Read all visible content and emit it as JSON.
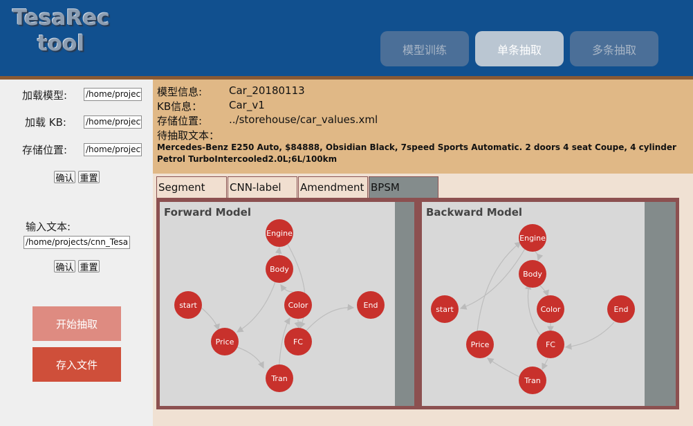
{
  "header": {
    "logo_line1": "TesaRec",
    "logo_line2": "tool",
    "nav": [
      {
        "label": "模型训练"
      },
      {
        "label": "单条抽取"
      },
      {
        "label": "多条抽取"
      }
    ]
  },
  "sidebar": {
    "load_model_label": "加载模型:",
    "load_model_value": "/home/projects",
    "load_kb_label": "加载 KB:",
    "load_kb_value": "/home/projects",
    "store_label": "存储位置:",
    "store_value": "/home/projects",
    "confirm_label": "确认",
    "reset_label": "重置",
    "input_text_label": "输入文本:",
    "input_text_value": "/home/projects/cnn_Tesa",
    "confirm2_label": "确认",
    "reset2_label": "重置",
    "start_button": "开始抽取",
    "save_button": "存入文件"
  },
  "info": {
    "model_label": "模型信息:",
    "model_value": "Car_20180113",
    "kb_label": "KB信息：",
    "kb_value": "Car_v1",
    "store_label": "存储位置:",
    "store_value": "../storehouse/car_values.xml",
    "text_label": "待抽取文本：",
    "text_value": "Mercedes-Benz E250 Auto, $84888, Obsidian Black, 7speed Sports Automatic. 2 doors 4 seat Coupe, 4 cylinder Petrol TurboIntercooled2.0L;6L/100km"
  },
  "tabs": [
    {
      "label": "Segment"
    },
    {
      "label": "CNN-label"
    },
    {
      "label": "Amendment"
    },
    {
      "label": "BPSM"
    }
  ],
  "graphs": {
    "forward": {
      "title": "Forward Model",
      "node_color": "#c8312c",
      "nodes": [
        "Engine",
        "Body",
        "start",
        "Color",
        "End",
        "Price",
        "FC",
        "Tran"
      ],
      "edges": [
        [
          "start",
          "Price"
        ],
        [
          "Price",
          "Tran"
        ],
        [
          "Tran",
          "Color"
        ],
        [
          "Color",
          "Body"
        ],
        [
          "Body",
          "Price"
        ],
        [
          "Engine",
          "FC"
        ],
        [
          "FC",
          "End"
        ],
        [
          "Color",
          "FC"
        ],
        [
          "Body",
          "Engine"
        ]
      ]
    },
    "backward": {
      "title": "Backward Model",
      "node_color": "#c8312c",
      "nodes": [
        "Engine",
        "Body",
        "start",
        "Color",
        "End",
        "Price",
        "FC",
        "Tran"
      ],
      "edges": [
        [
          "Engine",
          "Body"
        ],
        [
          "Engine",
          "start"
        ],
        [
          "Body",
          "Color"
        ],
        [
          "Price",
          "Engine"
        ],
        [
          "End",
          "FC"
        ],
        [
          "FC",
          "Tran"
        ],
        [
          "Tran",
          "Price"
        ],
        [
          "Color",
          "FC"
        ],
        [
          "FC",
          "Body"
        ]
      ]
    }
  }
}
